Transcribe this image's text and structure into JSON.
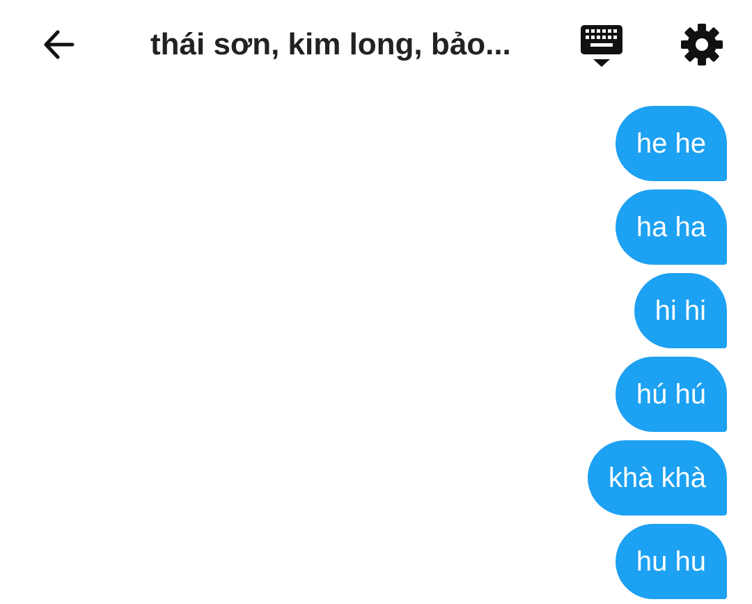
{
  "header": {
    "back_icon": "arrow-left-icon",
    "title": "thái sơn, kim long, bảo...",
    "keyboard_icon": "keyboard-hide-icon",
    "settings_icon": "gear-icon"
  },
  "messages": [
    {
      "text": "he he"
    },
    {
      "text": "ha ha"
    },
    {
      "text": "hi hi"
    },
    {
      "text": "hú hú"
    },
    {
      "text": "khà khà"
    },
    {
      "text": "hu hu"
    }
  ],
  "colors": {
    "bubble_bg": "#1da1f2",
    "bubble_text": "#ffffff",
    "title_text": "#222222"
  }
}
